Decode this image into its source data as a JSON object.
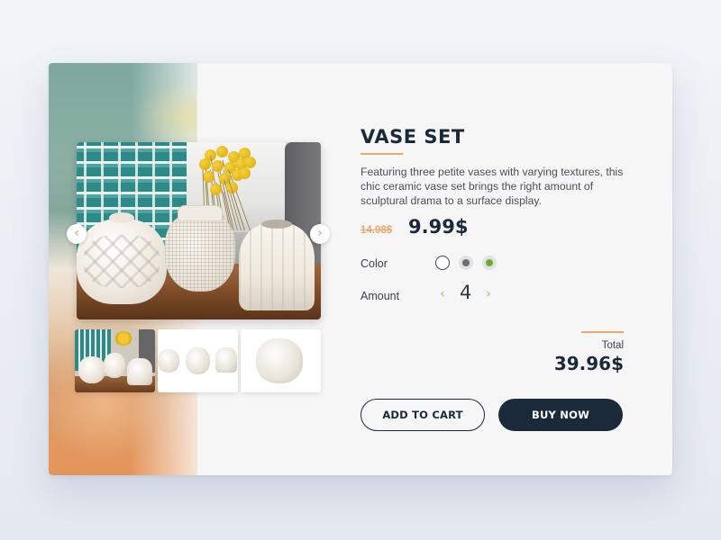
{
  "product": {
    "title": "VASE SET",
    "description": "Featuring three petite vases with varying textures, this chic ceramic vase set brings the right amount of sculptural drama to a surface display.",
    "old_price": "14.98$",
    "price": "9.99$"
  },
  "gallery": {
    "prev_icon": "‹",
    "next_icon": "›",
    "thumbnails": [
      {
        "label": "lifestyle-photo",
        "selected": true
      },
      {
        "label": "three-vases-white-background",
        "selected": false
      },
      {
        "label": "single-vase-white-background",
        "selected": false
      }
    ]
  },
  "options": {
    "color_label": "Color",
    "colors": [
      {
        "name": "white",
        "hex": "#ffffff",
        "selected": true
      },
      {
        "name": "gray",
        "hex": "#6e6e72",
        "selected": false
      },
      {
        "name": "green",
        "hex": "#6aad2e",
        "selected": false
      }
    ],
    "amount_label": "Amount",
    "amount_value": "4",
    "decrement_icon": "‹",
    "increment_icon": "›"
  },
  "total": {
    "label": "Total",
    "value": "39.96$"
  },
  "actions": {
    "add_to_cart": "ADD TO CART",
    "buy_now": "BUY NOW"
  },
  "colors": {
    "accent": "#eba86e",
    "primary": "#1b2a3a"
  }
}
